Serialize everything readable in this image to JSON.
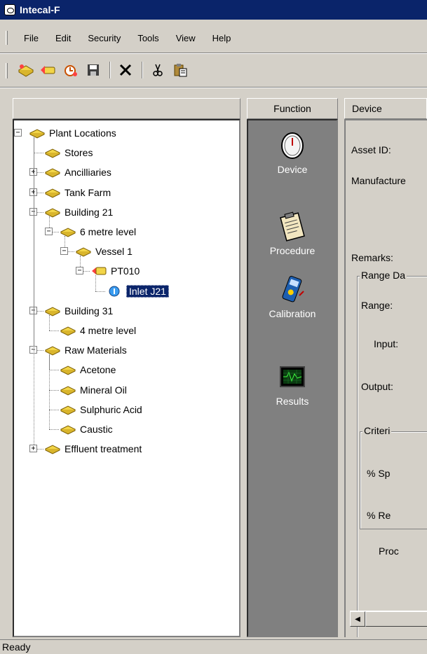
{
  "window": {
    "title": "Intecal-F"
  },
  "menu": [
    "File",
    "Edit",
    "Security",
    "Tools",
    "View",
    "Help"
  ],
  "toolbar": {
    "icons": [
      "new-location-icon",
      "new-device-icon",
      "new-procedure-icon",
      "save-icon",
      "delete-icon",
      "cut-icon",
      "paste-icon"
    ]
  },
  "tree": {
    "nodes": [
      {
        "label": "Plant Locations",
        "depth": 0,
        "expander": "minus",
        "icon": "location-icon"
      },
      {
        "label": "Stores",
        "depth": 1,
        "expander": "",
        "icon": "location-icon"
      },
      {
        "label": "Ancilliaries",
        "depth": 1,
        "expander": "plus",
        "icon": "location-icon"
      },
      {
        "label": "Tank Farm",
        "depth": 1,
        "expander": "plus",
        "icon": "location-icon"
      },
      {
        "label": "Building 21",
        "depth": 1,
        "expander": "minus",
        "icon": "location-icon"
      },
      {
        "label": "6 metre level",
        "depth": 2,
        "expander": "minus",
        "icon": "location-icon"
      },
      {
        "label": "Vessel 1",
        "depth": 3,
        "expander": "minus",
        "icon": "location-icon"
      },
      {
        "label": "PT010",
        "depth": 4,
        "expander": "minus",
        "icon": "device-tag-icon"
      },
      {
        "label": "Inlet J21",
        "depth": 5,
        "expander": "",
        "icon": "instrument-icon",
        "selected": true
      },
      {
        "label": "Building 31",
        "depth": 1,
        "expander": "minus",
        "icon": "location-icon"
      },
      {
        "label": "4 metre level",
        "depth": 2,
        "expander": "",
        "icon": "location-icon"
      },
      {
        "label": "Raw Materials",
        "depth": 1,
        "expander": "minus",
        "icon": "location-icon"
      },
      {
        "label": "Acetone",
        "depth": 2,
        "expander": "",
        "icon": "location-icon"
      },
      {
        "label": "Mineral Oil",
        "depth": 2,
        "expander": "",
        "icon": "location-icon"
      },
      {
        "label": "Sulphuric Acid",
        "depth": 2,
        "expander": "",
        "icon": "location-icon"
      },
      {
        "label": "Caustic",
        "depth": 2,
        "expander": "",
        "icon": "location-icon"
      },
      {
        "label": "Effluent treatment",
        "depth": 1,
        "expander": "plus",
        "icon": "location-icon"
      }
    ]
  },
  "function_panel": {
    "header": "Function",
    "items": [
      {
        "label": "Device",
        "icon": "gauge-icon"
      },
      {
        "label": "Procedure",
        "icon": "clipboard-icon"
      },
      {
        "label": "Calibration",
        "icon": "calibrator-icon"
      },
      {
        "label": "Results",
        "icon": "monitor-icon"
      }
    ]
  },
  "device_panel": {
    "header": "Device",
    "asset_id_label": "Asset ID:",
    "manufacturer_label": "Manufacture",
    "remarks_label": "Remarks:",
    "range_group_label": "Range Da",
    "range_label": "Range:",
    "input_label": "Input:",
    "output_label": "Output:",
    "criteria_group_label": "Criteri",
    "span_label": "% Sp",
    "reading_label": "% Re",
    "procedure_label": "Proc"
  },
  "status": {
    "text": "Ready"
  },
  "colors": {
    "titlebar": "#0a246a",
    "face": "#d4d0c8",
    "function_bg": "#808080",
    "selection": "#0a246a",
    "folder": "#f2d548"
  }
}
